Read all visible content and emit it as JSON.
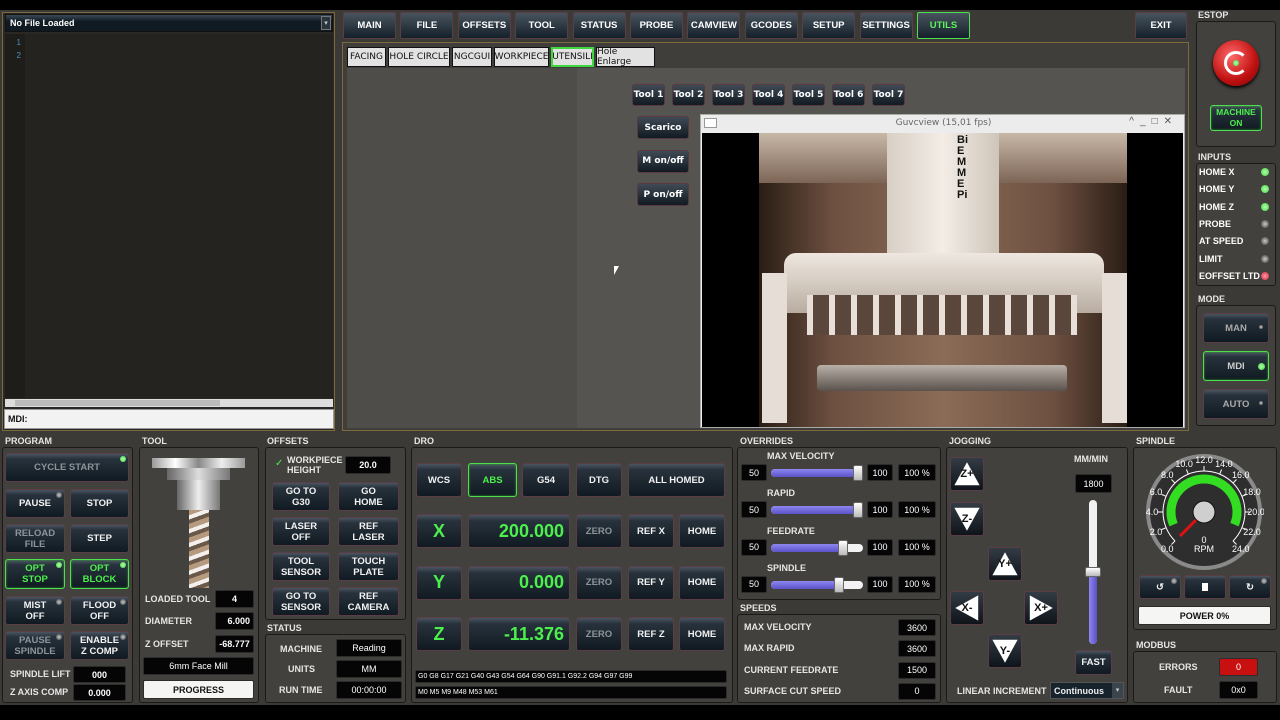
{
  "file_panel": {
    "title": "No File Loaded",
    "line_numbers": [
      "1",
      "2"
    ],
    "mdi_label": "MDI:"
  },
  "nav": {
    "tabs": [
      "MAIN",
      "FILE",
      "OFFSETS",
      "TOOL",
      "STATUS",
      "PROBE",
      "CAMVIEW",
      "GCODES",
      "SETUP",
      "SETTINGS",
      "UTILS"
    ],
    "active": "UTILS",
    "exit": "EXIT"
  },
  "utils": {
    "tabs": [
      "FACING",
      "HOLE CIRCLE",
      "NGCGUI",
      "WORKPIECE",
      "UTENSILI",
      "Hole Enlarge"
    ],
    "active": "UTENSILI",
    "tools": [
      "Tool 1",
      "Tool 2",
      "Tool 3",
      "Tool 4",
      "Tool 5",
      "Tool 6",
      "Tool 7"
    ],
    "actions": [
      "Scarico",
      "M on/off",
      "P on/off"
    ]
  },
  "camera": {
    "title": "Guvcview  (15,01 fps)",
    "logo_text": "BiEMMEPi"
  },
  "estop": {
    "label": "ESTOP",
    "machine_button": "MACHINE ON"
  },
  "inputs": {
    "label": "INPUTS",
    "items": [
      {
        "name": "HOME X",
        "state": "green"
      },
      {
        "name": "HOME Y",
        "state": "green"
      },
      {
        "name": "HOME Z",
        "state": "green"
      },
      {
        "name": "PROBE",
        "state": "off"
      },
      {
        "name": "AT SPEED",
        "state": "off"
      },
      {
        "name": "LIMIT",
        "state": "off"
      },
      {
        "name": "EOFFSET LTD",
        "state": "red"
      }
    ]
  },
  "mode": {
    "label": "MODE",
    "items": [
      "MAN",
      "MDI",
      "AUTO"
    ],
    "active": "MDI"
  },
  "program": {
    "label": "PROGRAM",
    "cycle_start": "CYCLE START",
    "pause": "PAUSE",
    "stop": "STOP",
    "reload": "RELOAD FILE",
    "step": "STEP",
    "opt_stop": "OPT STOP",
    "opt_block": "OPT BLOCK",
    "mist": "MIST OFF",
    "flood": "FLOOD OFF",
    "pause_spindle": "PAUSE SPINDLE",
    "zcomp": "ENABLE Z COMP",
    "spindle_lift_label": "SPINDLE LIFT",
    "spindle_lift": "000",
    "z_axis_comp_label": "Z AXIS COMP",
    "z_axis_comp": "0.000"
  },
  "tool": {
    "label": "TOOL",
    "loaded_label": "LOADED TOOL",
    "loaded": "4",
    "diameter_label": "DIAMETER",
    "diameter": "6.000",
    "zoffset_label": "Z OFFSET",
    "zoffset": "-68.777",
    "description": "6mm Face Mill",
    "progress": "PROGRESS"
  },
  "offsets": {
    "label": "OFFSETS",
    "workpiece_label": "WORKPIECE HEIGHT",
    "workpiece": "20.0",
    "buttons": [
      "GO TO G30",
      "GO HOME",
      "LASER OFF",
      "REF LASER",
      "TOOL SENSOR",
      "TOUCH PLATE",
      "GO TO SENSOR",
      "REF CAMERA"
    ]
  },
  "status": {
    "label": "STATUS",
    "machine_label": "MACHINE",
    "machine": "Reading",
    "units_label": "UNITS",
    "units": "MM",
    "runtime_label": "RUN TIME",
    "runtime": "00:00:00"
  },
  "dro": {
    "label": "DRO",
    "wcs": "WCS",
    "abs": "ABS",
    "g54": "G54",
    "dtg": "DTG",
    "homed": "ALL HOMED",
    "axes": [
      {
        "axis": "X",
        "value": "200.000",
        "ref": "REF X"
      },
      {
        "axis": "Y",
        "value": "0.000",
        "ref": "REF Y"
      },
      {
        "axis": "Z",
        "value": "-11.376",
        "ref": "REF Z"
      }
    ],
    "zero": "ZERO",
    "home": "HOME",
    "gcodes": "G0 G8 G17 G21 G40 G43 G54 G64 G90 G91.1 G92.2 G94 G97 G99",
    "mcodes": "M0 M5 M9 M48 M53 M61"
  },
  "overrides": {
    "label": "OVERRIDES",
    "items": [
      {
        "name": "MAX VELOCITY",
        "min": "50",
        "max": "100",
        "value": "100 %",
        "fraction": 1.0
      },
      {
        "name": "RAPID",
        "min": "50",
        "max": "100",
        "value": "100 %",
        "fraction": 1.0
      },
      {
        "name": "FEEDRATE",
        "min": "50",
        "max": "100",
        "value": "100 %",
        "fraction": 0.82
      },
      {
        "name": "SPINDLE",
        "min": "50",
        "max": "100",
        "value": "100 %",
        "fraction": 0.78
      }
    ]
  },
  "speeds": {
    "label": "SPEEDS",
    "items": [
      {
        "name": "MAX VELOCITY",
        "value": "3600"
      },
      {
        "name": "MAX RAPID",
        "value": "3600"
      },
      {
        "name": "CURRENT FEEDRATE",
        "value": "1500"
      },
      {
        "name": "SURFACE CUT SPEED",
        "value": "0"
      }
    ]
  },
  "jogging": {
    "label": "JOGGING",
    "units": "MM/MIN",
    "rate": "1800",
    "rate_fraction": 0.5,
    "fast": "FAST",
    "increment_label": "LINEAR INCREMENT",
    "increment": "Continuous",
    "buttons": [
      "Z+",
      "Z-",
      "Y+",
      "X-",
      "X+",
      "Y-"
    ]
  },
  "spindle": {
    "label": "SPINDLE",
    "rpm": "0",
    "rpm_label": "RPM",
    "scale": [
      "0.0",
      "2.0",
      "4.0",
      "6.0",
      "8.0",
      "10.0",
      "12.0",
      "14.0",
      "16.0",
      "18.0",
      "20.0",
      "22.0",
      "24.0"
    ],
    "power": "POWER 0%"
  },
  "modbus": {
    "label": "MODBUS",
    "errors_label": "ERRORS",
    "errors": "0",
    "fault_label": "FAULT",
    "fault": "0x0"
  },
  "colors": {
    "accent_green": "#4cf04c",
    "background": "#3b3a37",
    "error_red": "#c81010",
    "slider": "#6b63d8"
  }
}
